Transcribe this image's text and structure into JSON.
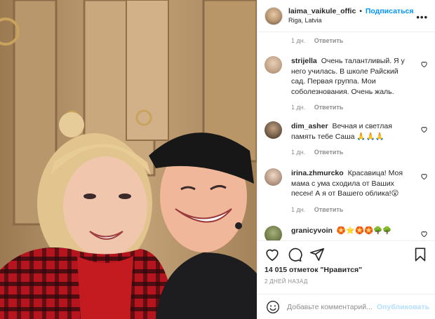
{
  "post": {
    "username": "laima_vaikule_offic",
    "separator": "•",
    "follow_label": "Подписаться",
    "location": "Riga, Latvia",
    "more_label": "•••"
  },
  "first_meta": {
    "time": "1 дн.",
    "reply": "Ответить"
  },
  "comments": [
    {
      "username": "strijella",
      "text": "Очень талантливый. Я у него училась. В школе Райский сад. Первая группа. Мои соболезнования. Очень жаль.",
      "time": "1 дн.",
      "reply": "Ответить"
    },
    {
      "username": "dim_asher",
      "text": "Вечная и светлая память тебе Саша 🙏🙏🙏",
      "time": "1 дн.",
      "reply": "Ответить"
    },
    {
      "username": "irina.zhmurcko",
      "text": "Красавица! Моя мама с ума сходила от Ваших песен! А я от Вашего облика!😮",
      "time": "1 дн.",
      "reply": "Ответить"
    },
    {
      "username": "granicyvoin",
      "text": "🏵️⭐🏵️🏵️🌳🌳",
      "time": "",
      "reply": ""
    }
  ],
  "likes_text": "14 015 отметок \"Нравится\"",
  "date_text": "2 ДНЕЙ НАЗАД",
  "add_comment": {
    "placeholder": "Добавьте комментарий...",
    "post_label": "Опубликовать"
  },
  "colors": {
    "accent": "#0095f6",
    "muted": "#8e8e8e",
    "text": "#262626"
  },
  "icons": [
    "heart-icon",
    "comment-icon",
    "share-icon",
    "bookmark-icon",
    "emoji-icon"
  ]
}
